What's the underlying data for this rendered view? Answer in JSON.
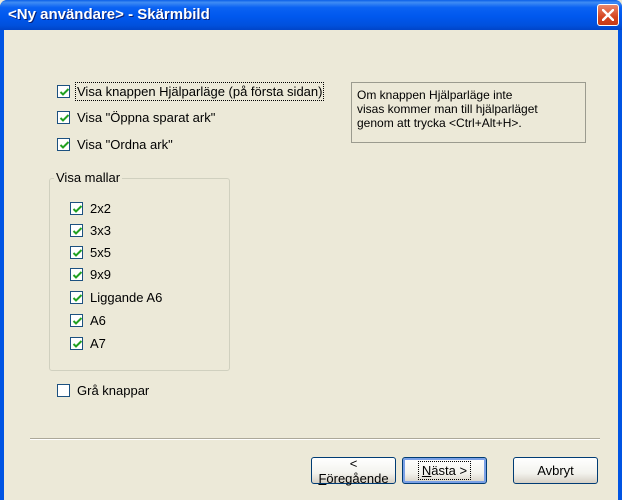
{
  "window": {
    "title": "<Ny användare> - Skärmbild"
  },
  "options": {
    "show_help_button": {
      "label": "Visa knappen Hjälparläge (på första sidan)",
      "checked": true
    },
    "show_open_saved": {
      "label": "Visa \"Öppna sparat ark\"",
      "checked": true
    },
    "show_arrange": {
      "label": "Visa \"Ordna ark\"",
      "checked": true
    },
    "gray_buttons": {
      "label": "Grå knappar",
      "checked": false
    }
  },
  "info_text": {
    "line1": "Om knappen Hjälparläge inte",
    "line2": "visas kommer man till hjälparläget",
    "line3": "genom att trycka <Ctrl+Alt+H>."
  },
  "templates": {
    "title": "Visa mallar",
    "items": [
      {
        "label": "2x2",
        "checked": true
      },
      {
        "label": "3x3",
        "checked": true
      },
      {
        "label": "5x5",
        "checked": true
      },
      {
        "label": "9x9",
        "checked": true
      },
      {
        "label": "Liggande A6",
        "checked": true
      },
      {
        "label": "A6",
        "checked": true
      },
      {
        "label": "A7",
        "checked": true
      }
    ]
  },
  "buttons": {
    "back": {
      "mnemonic": "F",
      "rest": "öregående",
      "prefix": "< "
    },
    "next": {
      "mnemonic": "N",
      "rest": "ästa >"
    },
    "cancel": "Avbryt"
  },
  "colors": {
    "titlebar": "#0054e3",
    "face": "#ece9d8",
    "check": "#21a121",
    "close": "#d54520"
  },
  "icons": {
    "close": "close-icon",
    "check": "checkmark-icon"
  }
}
